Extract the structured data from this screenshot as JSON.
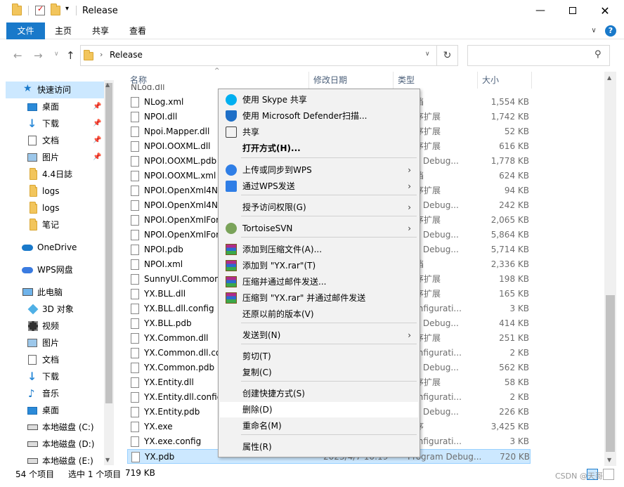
{
  "window": {
    "title": "Release",
    "ribbon_tabs": [
      "文件",
      "主页",
      "共享",
      "查看"
    ]
  },
  "address": {
    "path": "Release",
    "search_placeholder": ""
  },
  "nav": {
    "quick_access": "快速访问",
    "items": [
      {
        "label": "桌面",
        "pinned": true
      },
      {
        "label": "下载",
        "pinned": true
      },
      {
        "label": "文档",
        "pinned": true
      },
      {
        "label": "图片",
        "pinned": true
      },
      {
        "label": "4.4日誌",
        "pinned": false
      },
      {
        "label": "logs",
        "pinned": false
      },
      {
        "label": "logs",
        "pinned": false
      },
      {
        "label": "笔记",
        "pinned": false
      }
    ],
    "onedrive": "OneDrive",
    "wps": "WPS网盘",
    "this_pc": "此电脑",
    "pc_items": [
      "3D 对象",
      "视频",
      "图片",
      "文档",
      "下载",
      "音乐",
      "桌面",
      "本地磁盘 (C:)",
      "本地磁盘 (D:)",
      "本地磁盘 (E:)"
    ]
  },
  "columns": {
    "name": "名称",
    "date": "修改日期",
    "type": "类型",
    "size": "大小"
  },
  "files": [
    {
      "name": "NLog.xml",
      "date": "",
      "type": "文档",
      "size": "1,554 KB"
    },
    {
      "name": "NPOI.dll",
      "date": "",
      "type": "程序扩展",
      "size": "1,742 KB"
    },
    {
      "name": "Npoi.Mapper.dll",
      "date": "",
      "type": "程序扩展",
      "size": "52 KB"
    },
    {
      "name": "NPOI.OOXML.dll",
      "date": "",
      "type": "程序扩展",
      "size": "616 KB"
    },
    {
      "name": "NPOI.OOXML.pdb",
      "date": "",
      "type": "am Debug...",
      "size": "1,778 KB"
    },
    {
      "name": "NPOI.OOXML.xml",
      "date": "",
      "type": "文档",
      "size": "624 KB"
    },
    {
      "name": "NPOI.OpenXml4N",
      "date": "",
      "type": "程序扩展",
      "size": "94 KB"
    },
    {
      "name": "NPOI.OpenXml4N",
      "date": "",
      "type": "am Debug...",
      "size": "242 KB"
    },
    {
      "name": "NPOI.OpenXmlFor",
      "date": "",
      "type": "程序扩展",
      "size": "2,065 KB"
    },
    {
      "name": "NPOI.OpenXmlFor",
      "date": "",
      "type": "am Debug...",
      "size": "5,864 KB"
    },
    {
      "name": "NPOI.pdb",
      "date": "",
      "type": "am Debug...",
      "size": "5,714 KB"
    },
    {
      "name": "NPOI.xml",
      "date": "",
      "type": "文档",
      "size": "2,336 KB"
    },
    {
      "name": "SunnyUI.Common",
      "date": "",
      "type": "程序扩展",
      "size": "198 KB"
    },
    {
      "name": "YX.BLL.dll",
      "date": "",
      "type": "程序扩展",
      "size": "165 KB"
    },
    {
      "name": "YX.BLL.dll.config",
      "date": "",
      "type": "Configurati...",
      "size": "3 KB"
    },
    {
      "name": "YX.BLL.pdb",
      "date": "",
      "type": "am Debug...",
      "size": "414 KB"
    },
    {
      "name": "YX.Common.dll",
      "date": "",
      "type": "程序扩展",
      "size": "251 KB"
    },
    {
      "name": "YX.Common.dll.co",
      "date": "",
      "type": "Configurati...",
      "size": "2 KB"
    },
    {
      "name": "YX.Common.pdb",
      "date": "",
      "type": "am Debug...",
      "size": "562 KB"
    },
    {
      "name": "YX.Entity.dll",
      "date": "",
      "type": "程序扩展",
      "size": "58 KB"
    },
    {
      "name": "YX.Entity.dll.config",
      "date": "",
      "type": "Configurati...",
      "size": "2 KB"
    },
    {
      "name": "YX.Entity.pdb",
      "date": "",
      "type": "am Debug...",
      "size": "226 KB"
    },
    {
      "name": "YX.exe",
      "date": "",
      "type": "程序",
      "size": "3,425 KB"
    },
    {
      "name": "YX.exe.config",
      "date": "",
      "type": "Configurati...",
      "size": "3 KB"
    },
    {
      "name": "YX.pdb",
      "date": "2023/4/7 10:19",
      "type": "Program Debug...",
      "size": "720 KB"
    }
  ],
  "context_menu": {
    "items": [
      {
        "label": "使用 Skype 共享",
        "icon": "skype-icon",
        "bold": false,
        "sub": false
      },
      {
        "label": "使用 Microsoft Defender扫描...",
        "icon": "defender-shield-icon",
        "bold": false,
        "sub": false
      },
      {
        "label": "共享",
        "icon": "share-icon",
        "bold": false,
        "sub": false
      },
      {
        "label": "打开方式(H)...",
        "icon": "",
        "bold": true,
        "sub": false
      },
      {
        "label": "上传或同步到WPS",
        "icon": "wps-cloud-icon",
        "bold": false,
        "sub": true
      },
      {
        "label": "通过WPS发送",
        "icon": "wps-send-icon",
        "bold": false,
        "sub": true
      },
      {
        "label": "授予访问权限(G)",
        "icon": "",
        "bold": false,
        "sub": true
      },
      {
        "label": "TortoiseSVN",
        "icon": "tortoise-icon",
        "bold": false,
        "sub": true
      },
      {
        "label": "添加到压缩文件(A)...",
        "icon": "winrar-icon",
        "bold": false,
        "sub": false
      },
      {
        "label": "添加到 \"YX.rar\"(T)",
        "icon": "winrar-icon",
        "bold": false,
        "sub": false
      },
      {
        "label": "压缩并通过邮件发送...",
        "icon": "winrar-icon",
        "bold": false,
        "sub": false
      },
      {
        "label": "压缩到 \"YX.rar\" 并通过邮件发送",
        "icon": "winrar-icon",
        "bold": false,
        "sub": false
      },
      {
        "label": "还原以前的版本(V)",
        "icon": "",
        "bold": false,
        "sub": false
      },
      {
        "label": "发送到(N)",
        "icon": "",
        "bold": false,
        "sub": true
      },
      {
        "label": "剪切(T)",
        "icon": "",
        "bold": false,
        "sub": false
      },
      {
        "label": "复制(C)",
        "icon": "",
        "bold": false,
        "sub": false
      },
      {
        "label": "创建快捷方式(S)",
        "icon": "",
        "bold": false,
        "sub": false
      },
      {
        "label": "删除(D)",
        "icon": "",
        "bold": false,
        "sub": false
      },
      {
        "label": "重命名(M)",
        "icon": "",
        "bold": false,
        "sub": false
      },
      {
        "label": "属性(R)",
        "icon": "",
        "bold": false,
        "sub": false
      }
    ]
  },
  "status": {
    "count": "54 个项目",
    "selected": "选中 1 个项目",
    "size": "719 KB"
  },
  "watermark": "CSDN @天哥"
}
